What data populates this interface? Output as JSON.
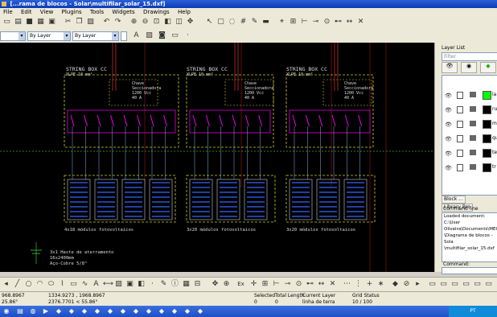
{
  "window": {
    "title": "[...rama de blocos - Solar\\multifilar_solar_15.dxf]"
  },
  "menu": [
    "File",
    "Edit",
    "View",
    "Plugins",
    "Tools",
    "Widgets",
    "Drawings",
    "Help"
  ],
  "toolbar2": {
    "combo1": "",
    "combo2": "By Layer",
    "combo3": "By Layer",
    "combo4": "By Layer"
  },
  "drawing": {
    "box_titles": [
      "STRING BOX CC",
      "STRING BOX CC",
      "STRING BOX CC"
    ],
    "box_subtitles": [
      "XLPE 10 mm²",
      "XLPE 10 mm²",
      "XLPE 10 mm²"
    ],
    "switch_lines": [
      "Chave",
      "Seccionadora",
      "1200 Vcc",
      "40 A"
    ],
    "module_labels": [
      "4x18 módulos fotovoltaicos",
      "3x20 módulos fotovoltaicos",
      "3x20 módulos fotovoltaicos"
    ],
    "ground_lines": [
      "3x1 Haste de aterramento",
      "16x2400mm",
      "Aço-Cobre 5/8\""
    ]
  },
  "dock": {
    "layer_list_title": "Layer List",
    "filter_placeholder": "Filter",
    "layers": [
      {
        "name": "la",
        "color": "#00ff00"
      },
      {
        "name": "ru",
        "color": "#000000"
      },
      {
        "name": "ma",
        "color": "#000000"
      },
      {
        "name": "qu",
        "color": "#000000"
      },
      {
        "name": "te",
        "color": "#000000"
      },
      {
        "name": "tr",
        "color": "#000000"
      }
    ],
    "tabs": [
      "Block ...",
      "Library Bro"
    ],
    "command_line_title": "Command line",
    "command_output": [
      "Loaded document: C:\\User",
      "Oliveira\\Documents\\MEGAs",
      "\\Diagrama de blocos - Sola",
      "\\multifilar_solar_15.dxf"
    ],
    "command_label": "Command:"
  },
  "status": {
    "abs_coord": "968.8967",
    "abs_coord2": "25.86°",
    "rel_coord": "1334.9273 , 1968.8967",
    "rel_coord2": "2376.7701 < 55.86°",
    "selected_label": "Selected",
    "selected_value": "0",
    "total_length_label": "Total Length",
    "total_length_value": "0",
    "current_layer_label": "Current Layer",
    "current_layer_value": "linha de terra",
    "grid_status_label": "Grid Status",
    "grid_status_value": "10 / 100"
  },
  "taskbar": {
    "lang": "PT"
  },
  "colors": {
    "canvas_bg": "#000000",
    "dock_bg": "#ece9d8",
    "title_blue": "#0a3bb5"
  }
}
